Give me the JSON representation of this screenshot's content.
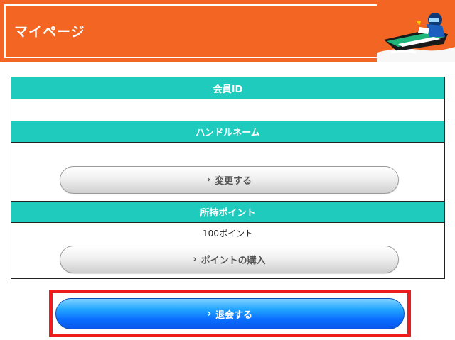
{
  "header": {
    "title": "マイページ",
    "bg_color": "#f26522"
  },
  "member_id": {
    "label": "会員ID",
    "value": ""
  },
  "handle_name": {
    "label": "ハンドルネーム",
    "value": "",
    "change_button": "変更する"
  },
  "points": {
    "label": "所持ポイント",
    "value": "100ポイント",
    "buy_button": "ポイントの購入"
  },
  "withdraw": {
    "button": "退会する"
  },
  "colors": {
    "section_header": "#1ecbbd",
    "withdraw_button": "#0a6dff",
    "highlight_frame": "#ee1c1c"
  }
}
